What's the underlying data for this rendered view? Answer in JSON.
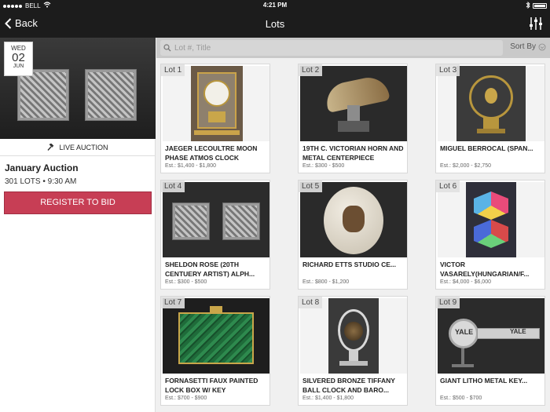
{
  "status": {
    "carrier": "BELL",
    "time": "4:21 PM"
  },
  "nav": {
    "back_label": "Back",
    "title": "Lots"
  },
  "auction": {
    "date": {
      "dow": "WED",
      "day": "02",
      "month": "JUN"
    },
    "live_label": "LIVE AUCTION",
    "title": "January Auction",
    "meta": "301 LOTS • 9:30 AM",
    "register_label": "REGISTER TO BID"
  },
  "search": {
    "placeholder": "Lot #, Title",
    "sort_label": "Sort By"
  },
  "lots": [
    {
      "label": "Lot 1",
      "title": "JAEGER LECOULTRE MOON PHASE ATMOS CLOCK",
      "estimate": "Est.: $1,400 - $1,800"
    },
    {
      "label": "Lot 2",
      "title": "19TH C. VICTORIAN HORN AND METAL CENTERPIECE",
      "estimate": "Est.: $300 - $500"
    },
    {
      "label": "Lot 3",
      "title": "MIGUEL BERROCAL (SPAN...",
      "estimate": "Est.: $2,000 - $2,750"
    },
    {
      "label": "Lot 4",
      "title": "SHELDON ROSE (20TH CENTUERY ARTIST) ALPH...",
      "estimate": "Est.: $300 - $500"
    },
    {
      "label": "Lot 5",
      "title": "RICHARD ETTS STUDIO CE...",
      "estimate": "Est.: $800 - $1,200"
    },
    {
      "label": "Lot 6",
      "title": "VICTOR VASARELY(HUNGARIAN/F...",
      "estimate": "Est.: $4,000 - $6,000"
    },
    {
      "label": "Lot 7",
      "title": "FORNASETTI FAUX PAINTED LOCK BOX W/ KEY",
      "estimate": "Est.: $700 - $900"
    },
    {
      "label": "Lot 8",
      "title": "SILVERED BRONZE TIFFANY BALL CLOCK AND BARO...",
      "estimate": "Est.: $1,400 - $1,800"
    },
    {
      "label": "Lot 9",
      "title": "GIANT LITHO METAL KEY...",
      "estimate": "Est.: $500 - $700"
    }
  ],
  "lot9_key_text": "YALE",
  "colors": {
    "accent": "#c73e55",
    "bar": "#1c1c1c"
  }
}
